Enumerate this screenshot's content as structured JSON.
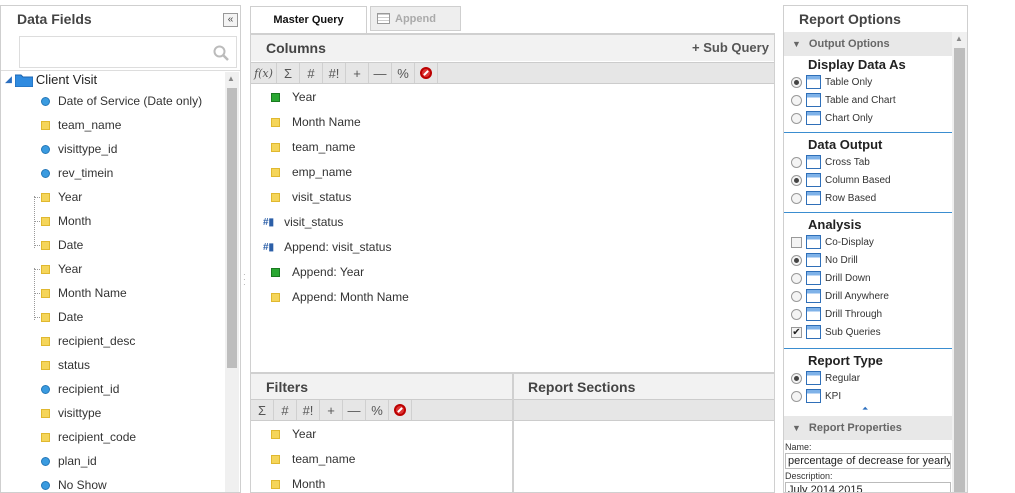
{
  "data_fields": {
    "title": "Data Fields",
    "root": "Client Visit",
    "items": [
      {
        "label": "Date of Service (Date only)",
        "icon": "dot",
        "indent": 0
      },
      {
        "label": "team_name",
        "icon": "square",
        "indent": 0
      },
      {
        "label": "visittype_id",
        "icon": "dot",
        "indent": 0
      },
      {
        "label": "rev_timein",
        "icon": "dot",
        "indent": 0
      },
      {
        "label": "Year",
        "icon": "square",
        "indent": 1
      },
      {
        "label": "Month",
        "icon": "square",
        "indent": 1
      },
      {
        "label": "Date",
        "icon": "square",
        "indent": 1
      },
      {
        "label": "Year",
        "icon": "square",
        "indent": 1
      },
      {
        "label": "Month Name",
        "icon": "square",
        "indent": 1
      },
      {
        "label": "Date",
        "icon": "square",
        "indent": 1
      },
      {
        "label": "recipient_desc",
        "icon": "square",
        "indent": 0
      },
      {
        "label": "status",
        "icon": "square",
        "indent": 0
      },
      {
        "label": "recipient_id",
        "icon": "dot",
        "indent": 0
      },
      {
        "label": "visittype",
        "icon": "square",
        "indent": 0
      },
      {
        "label": "recipient_code",
        "icon": "square",
        "indent": 0
      },
      {
        "label": "plan_id",
        "icon": "dot",
        "indent": 0
      },
      {
        "label": "No Show",
        "icon": "dot",
        "indent": 0
      }
    ]
  },
  "tabs": {
    "master": "Master Query",
    "append": "Append"
  },
  "columns": {
    "title": "Columns",
    "sub_query": "+ Sub Query",
    "toolbar": [
      "f(x)",
      "Σ",
      "#",
      "#!",
      "+",
      "—",
      "%"
    ],
    "items": [
      {
        "label": "Year",
        "icon": "green"
      },
      {
        "label": "Month Name",
        "icon": "square"
      },
      {
        "label": "team_name",
        "icon": "square"
      },
      {
        "label": "emp_name",
        "icon": "square"
      },
      {
        "label": "visit_status",
        "icon": "square"
      },
      {
        "label": "visit_status",
        "icon": "hash"
      },
      {
        "label": "Append: visit_status",
        "icon": "hash"
      },
      {
        "label": "Append: Year",
        "icon": "green"
      },
      {
        "label": "Append: Month Name",
        "icon": "square"
      }
    ]
  },
  "filters": {
    "title": "Filters",
    "toolbar": [
      "Σ",
      "#",
      "#!",
      "+",
      "—",
      "%"
    ],
    "items": [
      {
        "label": "Year",
        "icon": "square"
      },
      {
        "label": "team_name",
        "icon": "square"
      },
      {
        "label": "Month",
        "icon": "square"
      }
    ]
  },
  "report_sections": {
    "title": "Report Sections"
  },
  "report_options": {
    "title": "Report Options",
    "output_options": "Output Options",
    "display_as": {
      "title": "Display Data As",
      "options": [
        {
          "label": "Table Only",
          "selected": true
        },
        {
          "label": "Table and Chart",
          "selected": false
        },
        {
          "label": "Chart Only",
          "selected": false
        }
      ]
    },
    "data_output": {
      "title": "Data Output",
      "options": [
        {
          "label": "Cross Tab",
          "selected": false
        },
        {
          "label": "Column Based",
          "selected": true
        },
        {
          "label": "Row Based",
          "selected": false
        }
      ]
    },
    "analysis": {
      "title": "Analysis",
      "options": [
        {
          "label": "Co-Display",
          "type": "checkbox",
          "checked": false
        },
        {
          "label": "No Drill",
          "type": "radio",
          "selected": true
        },
        {
          "label": "Drill Down",
          "type": "radio",
          "selected": false
        },
        {
          "label": "Drill Anywhere",
          "type": "radio",
          "selected": false
        },
        {
          "label": "Drill Through",
          "type": "radio",
          "selected": false
        },
        {
          "label": "Sub Queries",
          "type": "checkbox",
          "checked": true
        }
      ]
    },
    "report_type": {
      "title": "Report Type",
      "options": [
        {
          "label": "Regular",
          "selected": true
        },
        {
          "label": "KPI",
          "selected": false
        }
      ]
    },
    "report_properties": "Report Properties",
    "name_label": "Name:",
    "name_value": "percentage of decrease for yearly",
    "description_label": "Description:",
    "description_value": "July 2014 2015"
  }
}
